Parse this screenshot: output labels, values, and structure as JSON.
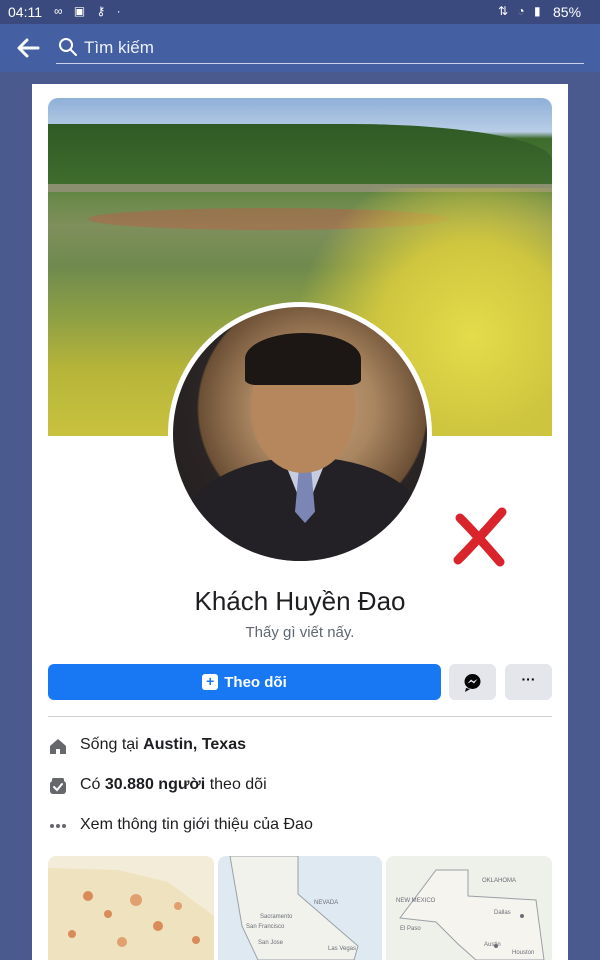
{
  "status_bar": {
    "time": "04:11",
    "battery": "85%"
  },
  "search": {
    "placeholder": "Tìm kiếm"
  },
  "profile": {
    "name": "Khách Huyền Đao",
    "bio": "Thấy gì viết nấy.",
    "follow_label": "Theo dõi",
    "more_label": "···"
  },
  "info": {
    "lives_prefix": "Sống tại ",
    "lives_city": "Austin, Texas",
    "followers_prefix": "Có ",
    "followers_count": "30.880 người",
    "followers_suffix": " theo dõi",
    "about_label": "Xem thông tin giới thiệu của Đao"
  },
  "maps": {
    "labels": [
      "NEVADA",
      "Sacramento",
      "San Francisco",
      "Las Vegas",
      "San Jose",
      "OKLAHOMA",
      "NEW MEXICO",
      "Dallas",
      "El Paso",
      "Austin",
      "Houston"
    ]
  },
  "colors": {
    "header_blue": "#4460a3",
    "follow_blue": "#1877f2",
    "annotation_red": "#d8242a"
  }
}
